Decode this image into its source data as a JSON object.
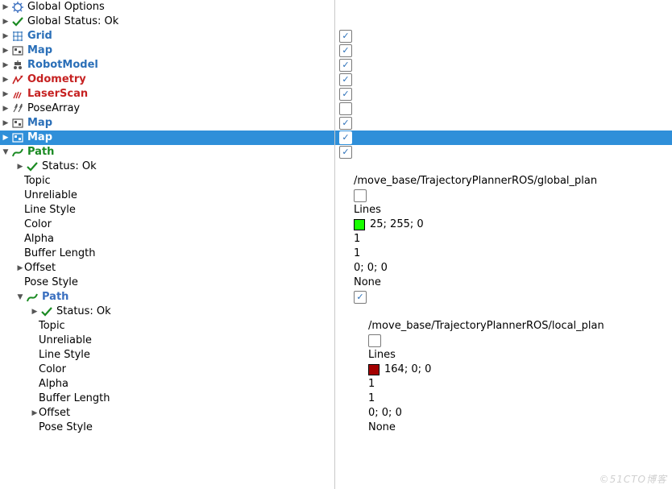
{
  "watermark": "©51CTO博客",
  "checkbox_glyph": "✓",
  "items": [
    {
      "indent": 0,
      "tri": "right",
      "ico": "gear-blue",
      "label": "Global Options",
      "bold": false
    },
    {
      "indent": 0,
      "tri": "right",
      "ico": "check-green",
      "label": "Global Status: Ok",
      "bold": false
    },
    {
      "indent": 0,
      "tri": "right",
      "ico": "grid-blue",
      "label": "Grid",
      "bold": true,
      "cls": "c-blue",
      "chk": true
    },
    {
      "indent": 0,
      "tri": "right",
      "ico": "map",
      "label": "Map",
      "bold": true,
      "cls": "c-blue",
      "chk": true
    },
    {
      "indent": 0,
      "tri": "right",
      "ico": "robot",
      "label": "RobotModel",
      "bold": true,
      "cls": "c-blue",
      "chk": true
    },
    {
      "indent": 0,
      "tri": "right",
      "ico": "odom-red",
      "label": "Odometry",
      "bold": true,
      "cls": "c-red",
      "chk": true
    },
    {
      "indent": 0,
      "tri": "right",
      "ico": "laser-red",
      "label": "LaserScan",
      "bold": true,
      "cls": "c-red",
      "chk": true
    },
    {
      "indent": 0,
      "tri": "right",
      "ico": "pose",
      "label": "PoseArray",
      "bold": false,
      "chk": false
    },
    {
      "indent": 0,
      "tri": "right",
      "ico": "map",
      "label": "Map",
      "bold": true,
      "cls": "c-blue",
      "chk": true
    },
    {
      "indent": 0,
      "tri": "right",
      "ico": "map-white",
      "label": "Map",
      "bold": true,
      "chk": true,
      "selected": true
    },
    {
      "indent": 0,
      "tri": "down",
      "ico": "path-green",
      "label": "Path",
      "bold": true,
      "cls": "c-green",
      "chk": true
    },
    {
      "indent": 1,
      "tri": "right",
      "ico": "check-green",
      "label": "Status: Ok",
      "bold": false
    },
    {
      "indent": 1,
      "tri": "none",
      "ico": "none",
      "label": "Topic",
      "bold": false,
      "value": "/move_base/TrajectoryPlannerROS/global_plan"
    },
    {
      "indent": 1,
      "tri": "none",
      "ico": "none",
      "label": "Unreliable",
      "bold": false,
      "chk": false
    },
    {
      "indent": 1,
      "tri": "none",
      "ico": "none",
      "label": "Line Style",
      "bold": false,
      "value": "Lines"
    },
    {
      "indent": 1,
      "tri": "none",
      "ico": "none",
      "label": "Color",
      "bold": false,
      "swatch": "#19ff00",
      "value": "25; 255; 0"
    },
    {
      "indent": 1,
      "tri": "none",
      "ico": "none",
      "label": "Alpha",
      "bold": false,
      "value": "1"
    },
    {
      "indent": 1,
      "tri": "none",
      "ico": "none",
      "label": "Buffer Length",
      "bold": false,
      "value": "1"
    },
    {
      "indent": 1,
      "tri": "right",
      "ico": "none",
      "label": "Offset",
      "bold": false,
      "value": "0; 0; 0"
    },
    {
      "indent": 1,
      "tri": "none",
      "ico": "none",
      "label": "Pose Style",
      "bold": false,
      "value": "None"
    },
    {
      "indent": 1,
      "tri": "down",
      "ico": "path-green",
      "label": "Path",
      "bold": true,
      "cls": "c-blue2",
      "chk": true
    },
    {
      "indent": 2,
      "tri": "right",
      "ico": "check-green",
      "label": "Status: Ok",
      "bold": false
    },
    {
      "indent": 2,
      "tri": "none",
      "ico": "none",
      "label": "Topic",
      "bold": false,
      "value": "/move_base/TrajectoryPlannerROS/local_plan"
    },
    {
      "indent": 2,
      "tri": "none",
      "ico": "none",
      "label": "Unreliable",
      "bold": false,
      "chk": false
    },
    {
      "indent": 2,
      "tri": "none",
      "ico": "none",
      "label": "Line Style",
      "bold": false,
      "value": "Lines"
    },
    {
      "indent": 2,
      "tri": "none",
      "ico": "none",
      "label": "Color",
      "bold": false,
      "swatch": "#a40000",
      "value": "164; 0; 0"
    },
    {
      "indent": 2,
      "tri": "none",
      "ico": "none",
      "label": "Alpha",
      "bold": false,
      "value": "1"
    },
    {
      "indent": 2,
      "tri": "none",
      "ico": "none",
      "label": "Buffer Length",
      "bold": false,
      "value": "1"
    },
    {
      "indent": 2,
      "tri": "right",
      "ico": "none",
      "label": "Offset",
      "bold": false,
      "value": "0; 0; 0"
    },
    {
      "indent": 2,
      "tri": "none",
      "ico": "none",
      "label": "Pose Style",
      "bold": false,
      "value": "None"
    }
  ]
}
